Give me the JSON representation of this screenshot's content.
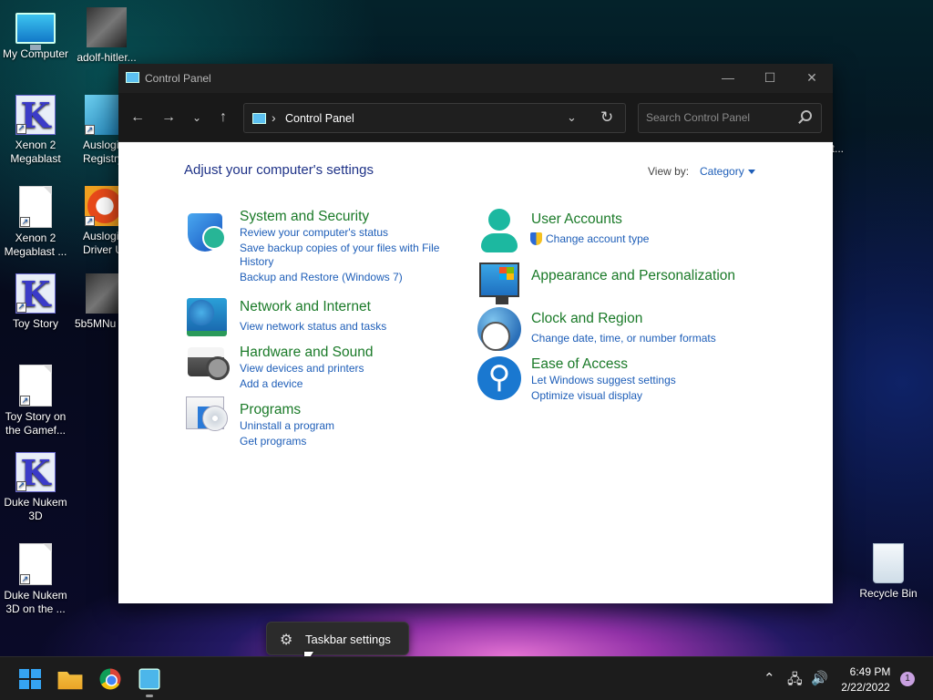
{
  "desktop": {
    "icons": [
      {
        "label": "My Computer"
      },
      {
        "label": "adolf-hitler..."
      },
      {
        "label": "Xenon 2 Megablast"
      },
      {
        "label": "Auslogi Registry"
      },
      {
        "label": "Xenon 2 Megablast ..."
      },
      {
        "label": "Auslogi Driver U"
      },
      {
        "label": "Toy Story"
      },
      {
        "label": "5b5MNu"
      },
      {
        "label": "Toy Story on the Gamef..."
      },
      {
        "label": "Duke Nukem 3D"
      },
      {
        "label": "Duke Nukem 3D on the ..."
      },
      {
        "label": "Recycle Bin"
      },
      {
        "label": "ot..."
      }
    ]
  },
  "window": {
    "title": "Control Panel",
    "address_crumb": "Control Panel",
    "search_placeholder": "Search Control Panel"
  },
  "content": {
    "heading": "Adjust your computer's settings",
    "view_by_label": "View by:",
    "view_by_value": "Category",
    "categories": [
      {
        "title": "System and Security",
        "icon": "shield-icon",
        "links": [
          "Review your computer's status",
          "Save backup copies of your files with File History",
          "Backup and Restore (Windows 7)"
        ]
      },
      {
        "title": "Network and Internet",
        "icon": "network-icon",
        "links": [
          "View network status and tasks"
        ]
      },
      {
        "title": "Hardware and Sound",
        "icon": "printer-icon",
        "links": [
          "View devices and printers",
          "Add a device"
        ]
      },
      {
        "title": "Programs",
        "icon": "programs-icon",
        "links": [
          "Uninstall a program",
          "Get programs"
        ]
      },
      {
        "title": "User Accounts",
        "icon": "user-icon",
        "links": [
          "Change account type"
        ]
      },
      {
        "title": "Appearance and Personalization",
        "icon": "appearance-icon",
        "links": []
      },
      {
        "title": "Clock and Region",
        "icon": "clock-icon",
        "links": [
          "Change date, time, or number formats"
        ]
      },
      {
        "title": "Ease of Access",
        "icon": "accessibility-icon",
        "links": [
          "Let Windows suggest settings",
          "Optimize visual display"
        ]
      }
    ]
  },
  "popup": {
    "label": "Taskbar settings"
  },
  "taskbar": {
    "time": "6:49 PM",
    "date": "2/22/2022",
    "notification_count": "1"
  },
  "colors": {
    "title_link": "#1a7a28",
    "link": "#1e5eb8",
    "heading": "#1e3287",
    "accent": "#35a4f2"
  }
}
